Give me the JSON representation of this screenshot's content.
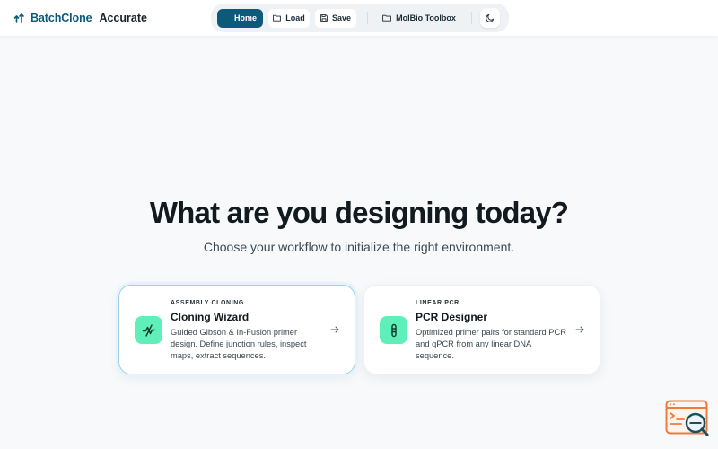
{
  "brand": {
    "name": "BatchClone",
    "subtitle": "Accurate",
    "icon": "branch-arrows-icon"
  },
  "nav": {
    "home_label": "Home",
    "load_label": "Load",
    "save_label": "Save",
    "toolbox_label": "MolBio Toolbox",
    "theme_icon": "moon-icon"
  },
  "hero": {
    "title": "What are you designing today?",
    "subtitle": "Choose your workflow to initialize the right environment."
  },
  "cards": [
    {
      "eyebrow": "ASSEMBLY CLONING",
      "title": "Cloning Wizard",
      "description": "Guided Gibson & In-Fusion primer design. Define junction rules, inspect maps, extract sequences.",
      "icon": "junction-icon",
      "selected": true
    },
    {
      "eyebrow": "LINEAR PCR",
      "title": "PCR Designer",
      "description": "Optimized primer pairs for standard PCR and qPCR from any linear DNA sequence.",
      "icon": "test-tube-icon",
      "selected": false
    }
  ],
  "colors": {
    "brand": "#0b5a7a",
    "accent": "#5ef0b8",
    "background": "#f7f9fb",
    "selected_border": "#9fcfe6"
  }
}
